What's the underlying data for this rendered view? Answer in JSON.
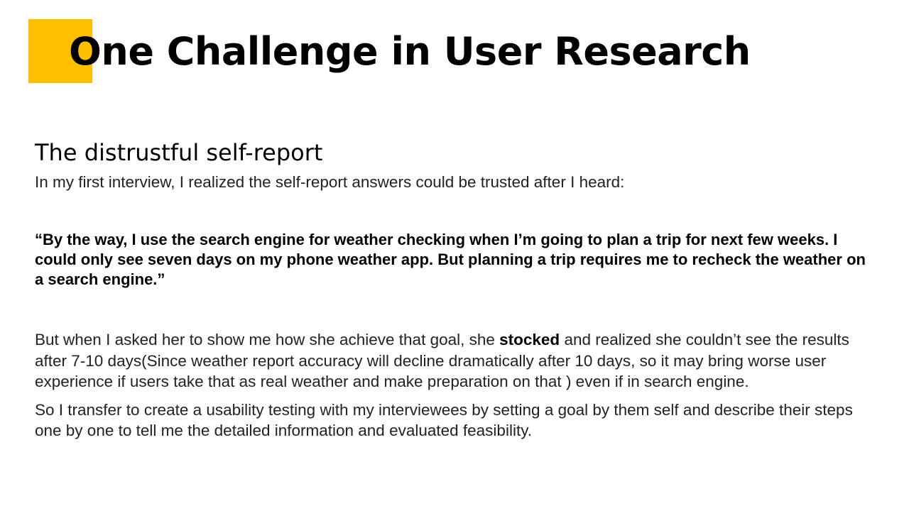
{
  "slide": {
    "title": "One Challenge in User Research",
    "accent_color": "#FFC000",
    "subtitle": "The distrustful self-report",
    "intro": "In my first interview, I realized the self-report answers could be trusted after I heard:",
    "quote": "“By the way, I use the search engine for weather checking when I’m going to plan a trip for next few weeks. I could only see seven days on my phone weather app. But planning a trip requires me to recheck the weather on a search engine.”",
    "paragraph1": {
      "before": "But when I asked her to show me how she achieve that goal, she ",
      "emphasis": "stocked",
      "after": " and realized she couldn’t see the results after 7-10 days(Since weather report accuracy will decline dramatically after 10 days, so it may bring worse user experience if users take that as real weather and make preparation on that ) even if in search engine."
    },
    "paragraph2": "So I transfer to create a usability testing with my interviewees by setting a goal by them self and describe their steps one by one to tell me the detailed information and evaluated feasibility."
  }
}
